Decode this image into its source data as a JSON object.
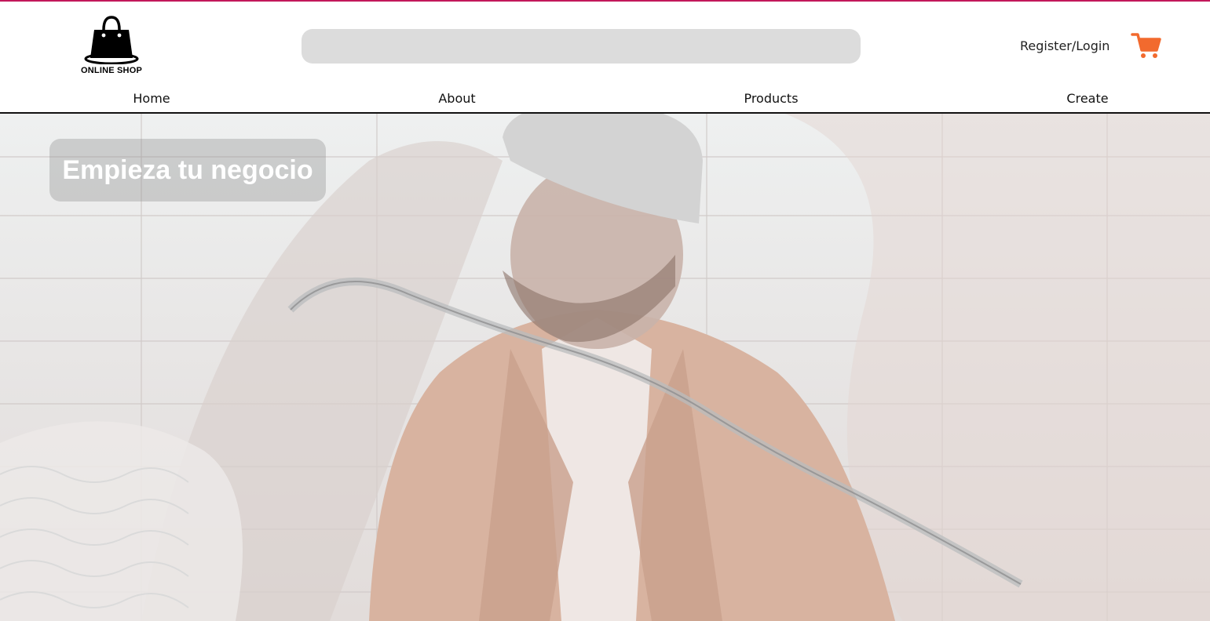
{
  "brand": {
    "name": "ONLINE SHOP",
    "icon": "shopping-bag-icon"
  },
  "header": {
    "search_placeholder": "",
    "search_value": "",
    "login_label": "Register/Login",
    "cart_icon": "shopping-cart-icon"
  },
  "nav": {
    "items": [
      {
        "label": "Home"
      },
      {
        "label": "About"
      },
      {
        "label": "Products"
      },
      {
        "label": "Create"
      }
    ]
  },
  "hero": {
    "title": "Empieza tu negocio",
    "image": "man-in-beanie-and-coat-photo"
  },
  "colors": {
    "accent_line": "#c2185b",
    "cart": "#f26a2e",
    "search_bg": "#dcdcdc"
  }
}
